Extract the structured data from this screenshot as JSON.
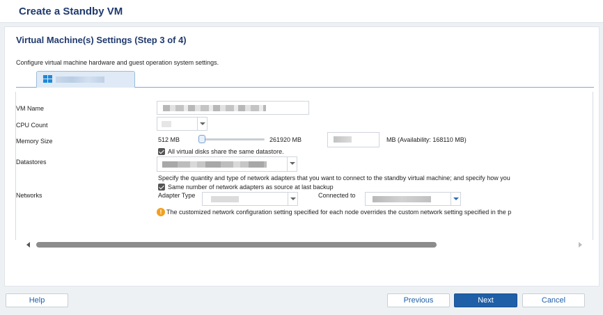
{
  "window": {
    "title": "Create a Standby VM"
  },
  "step": {
    "title": "Virtual Machine(s) Settings (Step 3 of 4)",
    "description": "Configure virtual machine hardware and guest operation system settings."
  },
  "tab": {
    "icon": "windows-logo-icon"
  },
  "form": {
    "vm_name_label": "VM Name",
    "cpu_count_label": "CPU Count",
    "memory_size_label": "Memory Size",
    "memory_min": "512 MB",
    "memory_max": "261920 MB",
    "memory_unit_availability": "MB (Availability: 168110 MB)",
    "datastores_label": "Datastores",
    "datastores_checkbox_label": "All virtual disks share the same datastore.",
    "networks_label": "Networks",
    "networks_description": "Specify the quantity and type of network adapters that you want to connect to the standby virtual machine; and specify how you",
    "networks_checkbox_label": "Same number of network adapters as source at last backup",
    "adapter_type_label": "Adapter Type",
    "connected_to_label": "Connected to",
    "warning_text": "The customized network configuration setting specified for each node overrides the custom network setting specified in the p",
    "warning_icon_glyph": "!"
  },
  "footer": {
    "help": "Help",
    "previous": "Previous",
    "next": "Next",
    "cancel": "Cancel"
  },
  "colors": {
    "title": "#1f3a6e",
    "primary_button": "#1f5fa8",
    "warning": "#f0a020",
    "windows_icon": "#1e88d8"
  }
}
